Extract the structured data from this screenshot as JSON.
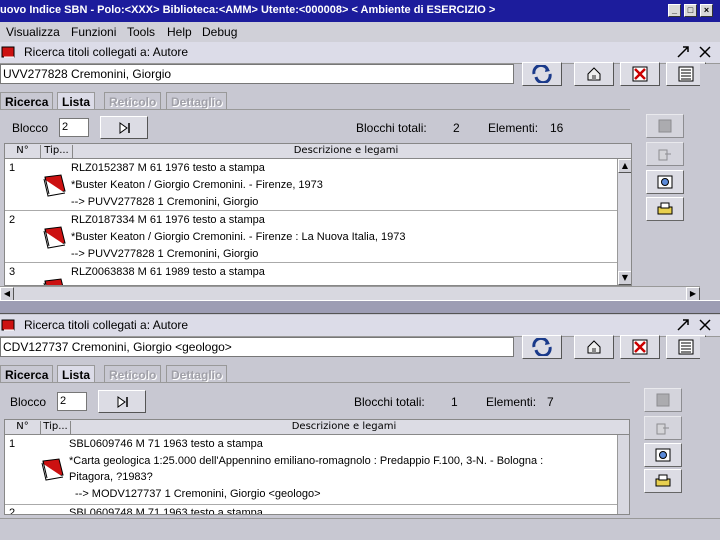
{
  "window": {
    "title": "uovo Indice SBN - Polo:<XXX> Biblioteca:<AMM> Utente:<000008>      < Ambiente di ESERCIZIO >",
    "min": "_",
    "max": "□",
    "close": "×"
  },
  "menu": [
    "Visualizza",
    "Funzioni",
    "Tools",
    "Help",
    "Debug"
  ],
  "panel1": {
    "title": "Ricerca titoli collegati a: Autore",
    "search_value": "UVV277828 Cremonini, Giorgio",
    "tabs": [
      "Ricerca",
      "Lista",
      "Reticolo",
      "Dettaglio"
    ],
    "blocco_label": "Blocco",
    "blocco_value": "2",
    "blocchi_label": "Blocchi totali:",
    "blocchi_value": "2",
    "elementi_label": "Elementi:",
    "elementi_value": "16",
    "headers": [
      "N°",
      "Tip...",
      "Descrizione e legami"
    ],
    "rows": [
      {
        "n": "1",
        "l1": "RLZ0152387 M 61 1976 testo a stampa",
        "l2": "*Buster Keaton / Giorgio Cremonini. - Firenze, 1973",
        "l3": "--> PUVV277828 1 Cremonini, Giorgio"
      },
      {
        "n": "2",
        "l1": "RLZ0187334 M 61 1976 testo a stampa",
        "l2": "*Buster Keaton / Giorgio Cremonini. - Firenze : La Nuova Italia, 1973",
        "l3": "--> PUVV277828 1 Cremonini, Giorgio"
      },
      {
        "n": "3",
        "l1": "RLZ0063838 M 61 1989 testo a stampa",
        "l2": "",
        "l3": ""
      }
    ]
  },
  "panel2": {
    "title": "Ricerca titoli collegati a: Autore",
    "search_value": "CDV127737 Cremonini, Giorgio <geologo>",
    "tabs": [
      "Ricerca",
      "Lista",
      "Reticolo",
      "Dettaglio"
    ],
    "blocco_label": "Blocco",
    "blocco_value": "2",
    "blocchi_label": "Blocchi totali:",
    "blocchi_value": "1",
    "elementi_label": "Elementi:",
    "elementi_value": "7",
    "headers": [
      "N°",
      "Tip...",
      "Descrizione e legami"
    ],
    "rows": [
      {
        "n": "1",
        "l1": "SBL0609746 M 71 1963 testo a stampa",
        "l2": "*Carta geologica 1:25.000 dell'Appennino emiliano-romagnolo : Predappio F.100, 3-N. - Bologna :",
        "l2b": "Pitagora, ?1983?",
        "l3": "--> MODV127737 1 Cremonini, Giorgio <geologo>"
      },
      {
        "n": "2",
        "l1": "SBL0609748 M 71 1963 testo a stampa",
        "l2": "",
        "l3": ""
      }
    ]
  },
  "colors": {
    "titlebar": "#1c1c9c",
    "panel": "#c8c8d2",
    "book_red": "#cc1111"
  }
}
